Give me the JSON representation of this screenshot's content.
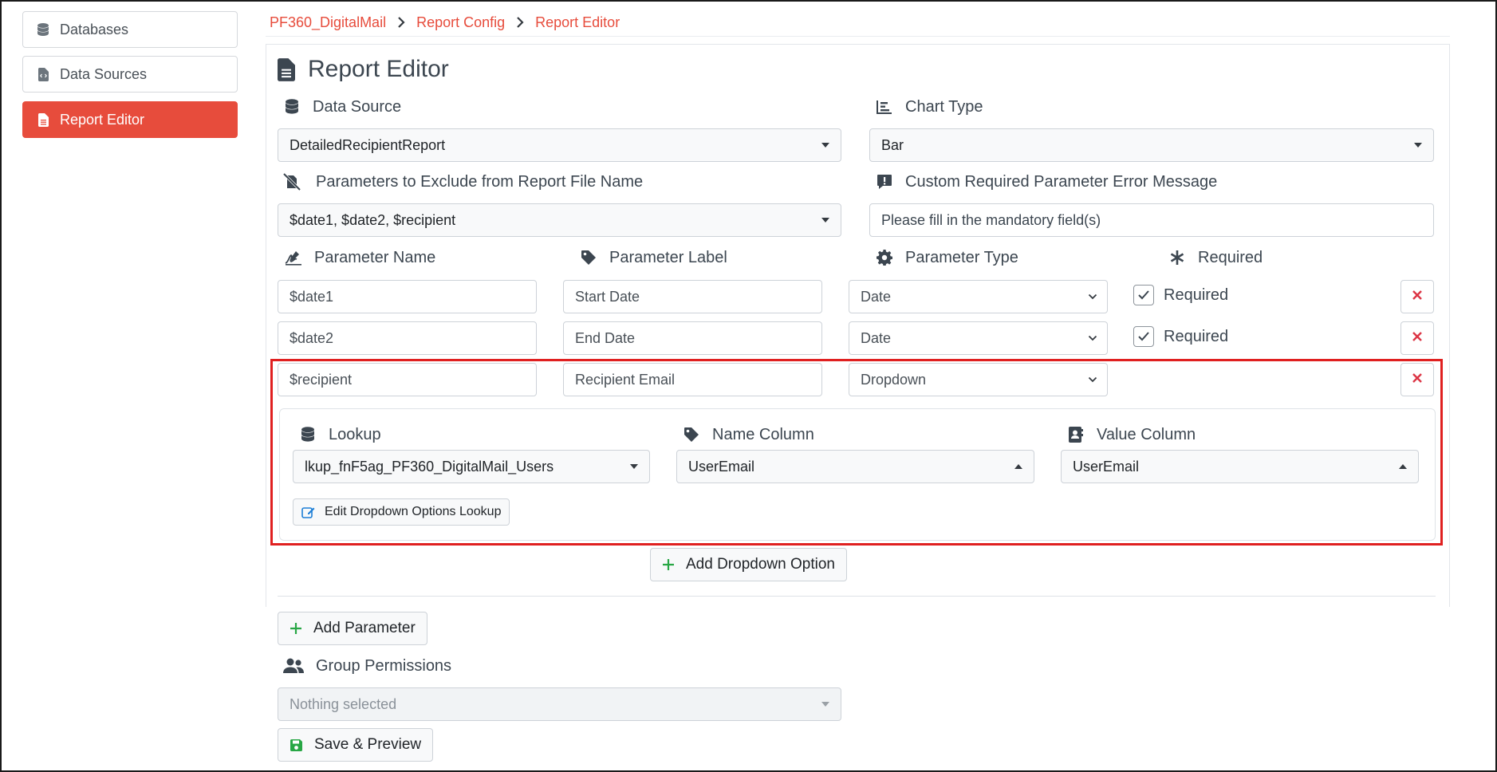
{
  "sidebar": {
    "items": [
      {
        "label": "Databases",
        "icon": "database-icon"
      },
      {
        "label": "Data Sources",
        "icon": "file-code-icon"
      },
      {
        "label": "Report Editor",
        "icon": "file-alt-icon",
        "active": true
      }
    ]
  },
  "breadcrumb": [
    "PF360_DigitalMail",
    "Report Config",
    "Report Editor"
  ],
  "page": {
    "title": "Report Editor"
  },
  "form": {
    "data_source": {
      "label": "Data Source",
      "value": "DetailedRecipientReport"
    },
    "chart_type": {
      "label": "Chart Type",
      "value": "Bar"
    },
    "exclude_params": {
      "label": "Parameters to Exclude from Report File Name",
      "value": "$date1, $date2, $recipient"
    },
    "custom_error": {
      "label": "Custom Required Parameter Error Message",
      "value": "Please fill in the mandatory field(s)"
    },
    "param_headers": {
      "name": "Parameter Name",
      "label": "Parameter Label",
      "type": "Parameter Type",
      "required": "Required"
    },
    "parameters": [
      {
        "name": "$date1",
        "label": "Start Date",
        "type": "Date",
        "required_label": "Required",
        "required": true
      },
      {
        "name": "$date2",
        "label": "End Date",
        "type": "Date",
        "required_label": "Required",
        "required": true
      },
      {
        "name": "$recipient",
        "label": "Recipient Email",
        "type": "Dropdown"
      }
    ],
    "dropdown": {
      "lookup_label": "Lookup",
      "lookup_value": "lkup_fnF5ag_PF360_DigitalMail_Users",
      "name_column_label": "Name Column",
      "name_column_value": "UserEmail",
      "value_column_label": "Value Column",
      "value_column_value": "UserEmail",
      "edit_button": "Edit Dropdown Options Lookup"
    },
    "add_dropdown_option": "Add Dropdown Option",
    "add_parameter": "Add Parameter",
    "group_permissions": {
      "label": "Group Permissions",
      "value": "Nothing selected"
    },
    "save_preview": "Save & Preview"
  },
  "colors": {
    "accent": "#e74c3c",
    "success": "#28a745",
    "danger": "#dc3545",
    "link": "#1c7ed6"
  }
}
